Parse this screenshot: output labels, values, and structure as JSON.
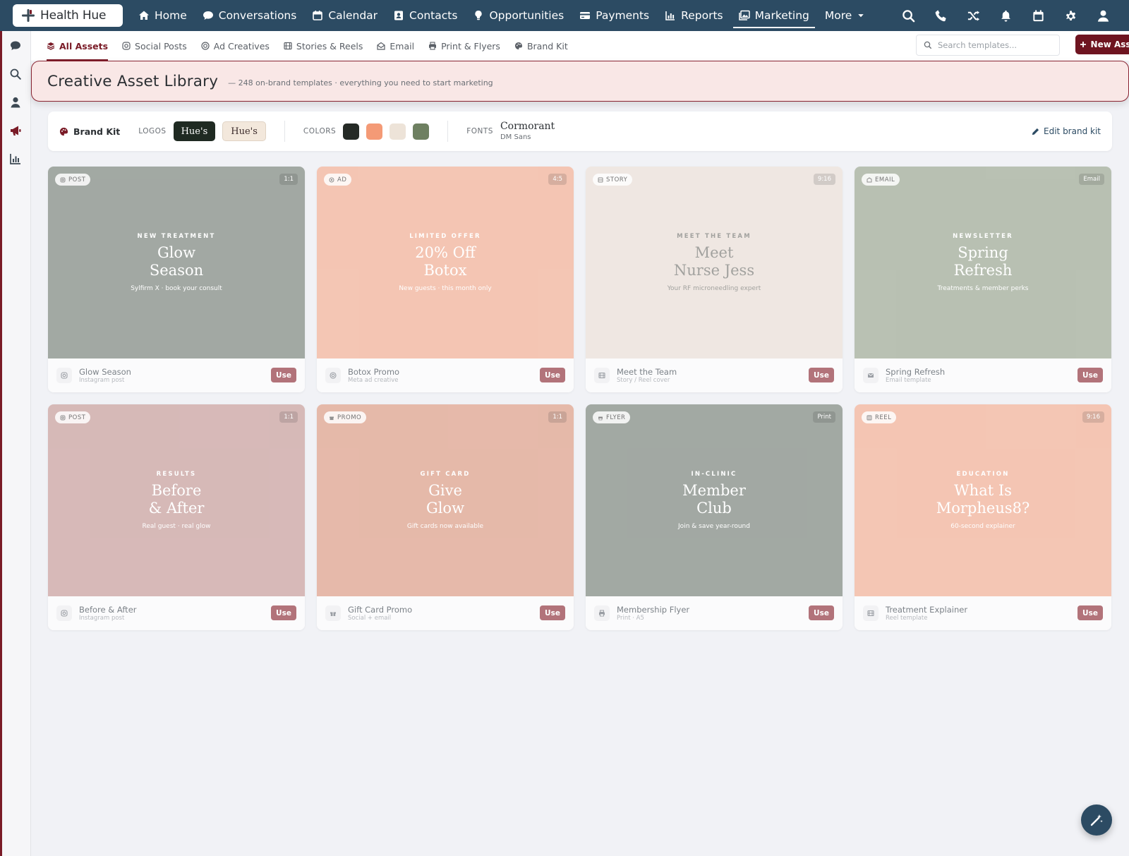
{
  "app": {
    "name": "Health Hue"
  },
  "topnav": {
    "items": [
      {
        "label": "Home",
        "icon": "home-icon"
      },
      {
        "label": "Conversations",
        "icon": "chat-icon"
      },
      {
        "label": "Calendar",
        "icon": "calendar-icon"
      },
      {
        "label": "Contacts",
        "icon": "contact-card-icon"
      },
      {
        "label": "Opportunities",
        "icon": "lightbulb-icon"
      },
      {
        "label": "Payments",
        "icon": "credit-card-icon"
      },
      {
        "label": "Reports",
        "icon": "bar-chart-icon"
      },
      {
        "label": "Marketing",
        "icon": "image-gallery-icon",
        "active": true
      },
      {
        "label": "More",
        "icon": "caret-down-icon"
      }
    ],
    "right_icons": [
      "search-icon",
      "phone-icon",
      "shuffle-icon",
      "bell-icon",
      "calendar-icon",
      "gear-icon",
      "user-icon"
    ]
  },
  "subnav": {
    "tabs": [
      {
        "label": "All Assets",
        "active": true
      },
      {
        "label": "Social Posts"
      },
      {
        "label": "Ad Creatives"
      },
      {
        "label": "Stories & Reels"
      },
      {
        "label": "Email"
      },
      {
        "label": "Print & Flyers"
      },
      {
        "label": "Brand Kit"
      }
    ],
    "search_placeholder": "Search templates...",
    "new_asset_label": "New Asset"
  },
  "banner": {
    "title": "Creative Asset Library",
    "subtitle": "— 248 on-brand templates · everything you need to start marketing"
  },
  "brand_kit": {
    "title": "Brand Kit",
    "logos_label": "LOGOS",
    "logo_dark": "Hue's",
    "logo_light": "Hue's",
    "colors_label": "COLORS",
    "colors": [
      "#252a26",
      "#f49a76",
      "#ede3d8",
      "#6e8061"
    ],
    "fonts_label": "FONTS",
    "font_primary": "Cormorant",
    "font_secondary": "DM Sans",
    "edit_label": "Edit brand kit"
  },
  "cards": [
    {
      "type": "POST",
      "ratio": "1:1",
      "eyebrow": "NEW TREATMENT",
      "headline_1": "Glow",
      "headline_2": "Season",
      "tagline": "Sylfirm X · book your consult",
      "name": "Glow Season",
      "sub": "Instagram post",
      "use": "Use",
      "bg": "#8e968f",
      "text": "#ffffff",
      "meta_icon": "instagram-icon"
    },
    {
      "type": "AD",
      "ratio": "4:5",
      "eyebrow": "LIMITED OFFER",
      "headline_1": "20% Off",
      "headline_2": "Botox",
      "tagline": "New guests · this month only",
      "name": "Botox Promo",
      "sub": "Meta ad creative",
      "use": "Use",
      "bg": "#f2b9a3",
      "text": "#ffffff",
      "meta_icon": "target-icon"
    },
    {
      "type": "STORY",
      "ratio": "9:16",
      "eyebrow": "MEET THE TEAM",
      "headline_1": "Meet",
      "headline_2": "Nurse Jess",
      "tagline": "Your RF microneedling expert",
      "name": "Meet the Team",
      "sub": "Story / Reel cover",
      "use": "Use",
      "bg": "#ece2dc",
      "text": "#8e8e8a",
      "meta_icon": "film-icon"
    },
    {
      "type": "EMAIL",
      "ratio": "Email",
      "eyebrow": "NEWSLETTER",
      "headline_1": "Spring",
      "headline_2": "Refresh",
      "tagline": "Treatments & member perks",
      "name": "Spring Refresh",
      "sub": "Email template",
      "use": "Use",
      "bg": "#a9b3a2",
      "text": "#ffffff",
      "meta_icon": "envelope-icon"
    },
    {
      "type": "POST",
      "ratio": "1:1",
      "eyebrow": "RESULTS",
      "headline_1": "Before",
      "headline_2": "& After",
      "tagline": "Real guest · real glow",
      "name": "Before & After",
      "sub": "Instagram post",
      "use": "Use",
      "bg": "#ceaaa8",
      "text": "#ffffff",
      "meta_icon": "instagram-icon"
    },
    {
      "type": "PROMO",
      "ratio": "1:1",
      "eyebrow": "GIFT CARD",
      "headline_1": "Give",
      "headline_2": "Glow",
      "tagline": "Gift cards now available",
      "name": "Gift Card Promo",
      "sub": "Social + email",
      "use": "Use",
      "bg": "#e0aa97",
      "text": "#ffffff",
      "meta_icon": "gift-icon"
    },
    {
      "type": "FLYER",
      "ratio": "Print",
      "eyebrow": "IN-CLINIC",
      "headline_1": "Member",
      "headline_2": "Club",
      "tagline": "Join & save year-round",
      "name": "Membership Flyer",
      "sub": "Print · A5",
      "use": "Use",
      "bg": "#8e968f",
      "text": "#ffffff",
      "meta_icon": "printer-icon"
    },
    {
      "type": "REEL",
      "ratio": "9:16",
      "eyebrow": "EDUCATION",
      "headline_1": "What Is",
      "headline_2": "Morpheus8?",
      "tagline": "60-second explainer",
      "name": "Treatment Explainer",
      "sub": "Reel template",
      "use": "Use",
      "bg": "#f2b9a3",
      "text": "#ffffff",
      "meta_icon": "film-icon"
    }
  ]
}
